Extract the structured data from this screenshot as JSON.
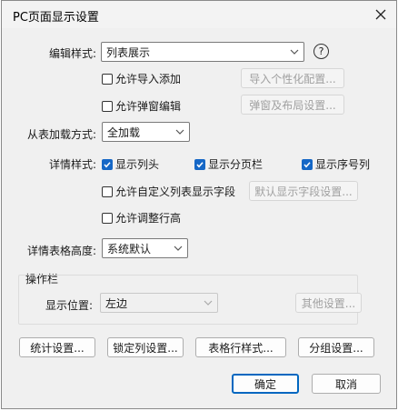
{
  "dialog": {
    "title": "PC页面显示设置"
  },
  "edit_style": {
    "label": "编辑样式:",
    "value": "列表展示",
    "allow_import": "允许导入添加",
    "import_config_button": "导入个性化配置...",
    "allow_popup_edit": "允许弹窗编辑",
    "popup_layout_button": "弹窗及布局设置..."
  },
  "subtable_load": {
    "label": "从表加载方式:",
    "value": "全加载"
  },
  "detail_style": {
    "label": "详情样式:",
    "show_header": "显示列头",
    "show_pager": "显示分页栏",
    "show_row_number": "显示序号列",
    "allow_custom_fields": "允许自定义列表显示字段",
    "default_fields_button": "默认显示字段设置...",
    "allow_row_height": "允许调整行高"
  },
  "detail_table_height": {
    "label": "详情表格高度:",
    "value": "系统默认"
  },
  "action_bar": {
    "legend": "操作栏",
    "position_label": "显示位置:",
    "position_value": "左边",
    "other_button": "其他设置..."
  },
  "footer": {
    "stats_button": "统计设置...",
    "lock_col_button": "锁定列设置...",
    "row_style_button": "表格行样式...",
    "group_button": "分组设置...",
    "ok_button": "确定",
    "cancel_button": "取消"
  },
  "colors": {
    "accent": "#0067c0",
    "checkbox": "#1567c6"
  },
  "icons": {
    "help": "?",
    "close": "close-icon",
    "dropdown": "chevron-down-icon"
  }
}
